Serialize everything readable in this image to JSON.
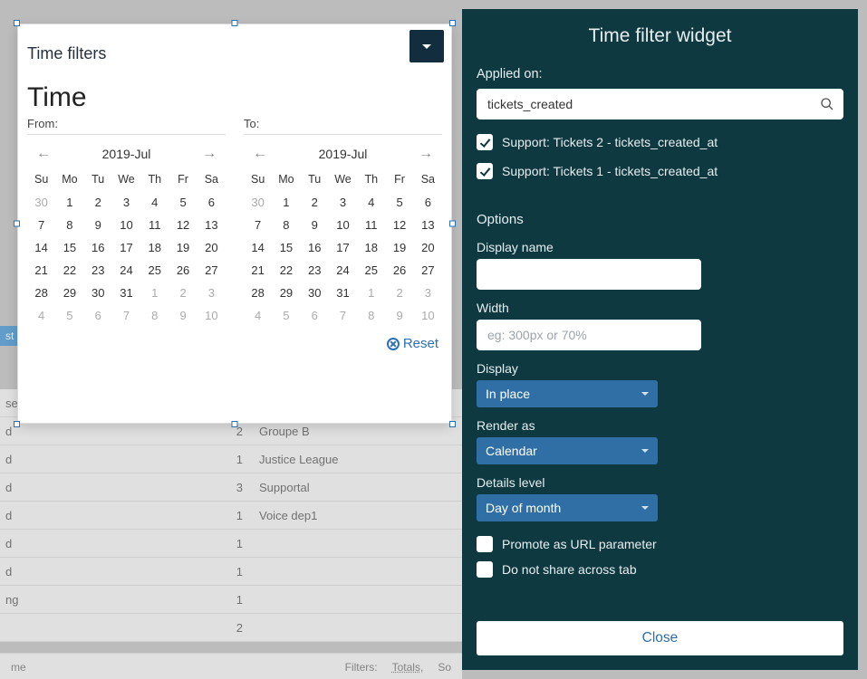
{
  "modal": {
    "title": "Time filters",
    "heading": "Time",
    "from_label": "From:",
    "to_label": "To:",
    "month": "2019-Jul",
    "reset": "Reset",
    "day_headers": [
      "Su",
      "Mo",
      "Tu",
      "We",
      "Th",
      "Fr",
      "Sa"
    ],
    "weeks": [
      [
        {
          "d": "30",
          "m": true
        },
        {
          "d": "1"
        },
        {
          "d": "2"
        },
        {
          "d": "3"
        },
        {
          "d": "4"
        },
        {
          "d": "5"
        },
        {
          "d": "6"
        }
      ],
      [
        {
          "d": "7"
        },
        {
          "d": "8"
        },
        {
          "d": "9"
        },
        {
          "d": "10"
        },
        {
          "d": "11"
        },
        {
          "d": "12"
        },
        {
          "d": "13"
        }
      ],
      [
        {
          "d": "14"
        },
        {
          "d": "15"
        },
        {
          "d": "16"
        },
        {
          "d": "17"
        },
        {
          "d": "18"
        },
        {
          "d": "19"
        },
        {
          "d": "20"
        }
      ],
      [
        {
          "d": "21"
        },
        {
          "d": "22"
        },
        {
          "d": "23"
        },
        {
          "d": "24"
        },
        {
          "d": "25"
        },
        {
          "d": "26"
        },
        {
          "d": "27"
        }
      ],
      [
        {
          "d": "28"
        },
        {
          "d": "29"
        },
        {
          "d": "30"
        },
        {
          "d": "31"
        },
        {
          "d": "1",
          "m": true
        },
        {
          "d": "2",
          "m": true
        },
        {
          "d": "3",
          "m": true
        }
      ],
      [
        {
          "d": "4",
          "m": true
        },
        {
          "d": "5",
          "m": true
        },
        {
          "d": "6",
          "m": true
        },
        {
          "d": "7",
          "m": true
        },
        {
          "d": "8",
          "m": true
        },
        {
          "d": "9",
          "m": true
        },
        {
          "d": "10",
          "m": true
        }
      ]
    ]
  },
  "sidebar": {
    "title": "Time filter widget",
    "applied_on_label": "Applied on:",
    "applied_on_value": "tickets_created",
    "checks": [
      {
        "label": "Support: Tickets 2 - tickets_created_at",
        "checked": true
      },
      {
        "label": "Support: Tickets 1 - tickets_created_at",
        "checked": true
      }
    ],
    "options_heading": "Options",
    "display_name_label": "Display name",
    "display_name_value": "",
    "width_label": "Width",
    "width_placeholder": "eg: 300px or 70%",
    "display_label": "Display",
    "display_value": "In place",
    "render_as_label": "Render as",
    "render_as_value": "Calendar",
    "details_level_label": "Details level",
    "details_level_value": "Day of month",
    "promote_label": "Promote as URL parameter",
    "share_label": "Do not share across tab",
    "close": "Close"
  },
  "bg": {
    "rows": [
      {
        "left": "sed",
        "num": "",
        "right": ""
      },
      {
        "left": "d",
        "num": "2",
        "right": "Groupe B"
      },
      {
        "left": "d",
        "num": "1",
        "right": "Justice League"
      },
      {
        "left": "d",
        "num": "3",
        "right": "Supportal"
      },
      {
        "left": "d",
        "num": "1",
        "right": "Voice dep1"
      },
      {
        "left": "d",
        "num": "1",
        "right": ""
      },
      {
        "left": "d",
        "num": "1",
        "right": ""
      },
      {
        "left": "ng",
        "num": "1",
        "right": ""
      },
      {
        "left": "",
        "num": "2",
        "right": ""
      }
    ],
    "footer_me": "me",
    "footer_filters": "Filters:",
    "footer_totals": "Totals,",
    "footer_so": "So",
    "pill": "st"
  }
}
